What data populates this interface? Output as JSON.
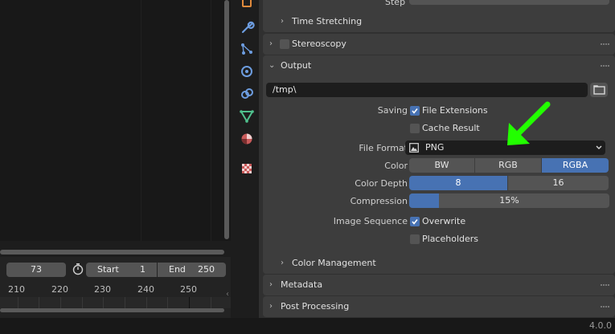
{
  "timeline": {
    "current_frame": "73",
    "start_label": "Start",
    "start_value": "1",
    "end_label": "End",
    "end_value": "250",
    "ticks": [
      "210",
      "220",
      "230",
      "240",
      "250"
    ]
  },
  "properties": {
    "step_label": "Step",
    "time_stretching": "Time Stretching",
    "stereoscopy": "Stereoscopy",
    "output": {
      "title": "Output",
      "path": "/tmp\\",
      "saving_label": "Saving",
      "file_extensions": "File Extensions",
      "cache_result": "Cache Result",
      "file_format_label": "File Format",
      "file_format_value": "PNG",
      "color_label": "Color",
      "color_options": [
        "BW",
        "RGB",
        "RGBA"
      ],
      "color_selected": "RGBA",
      "color_depth_label": "Color Depth",
      "color_depth_options": [
        "8",
        "16"
      ],
      "color_depth_selected": "8",
      "compression_label": "Compression",
      "compression_value": "15%",
      "compression_fraction": 0.15,
      "image_sequence_label": "Image Sequence",
      "overwrite": "Overwrite",
      "placeholders": "Placeholders"
    },
    "color_management": "Color Management",
    "metadata": "Metadata",
    "post_processing": "Post Processing"
  },
  "status": {
    "version": "4.0.0"
  },
  "colors": {
    "accent": "#4772b3",
    "annotation_arrow": "#22ff00",
    "panel": "#3d3d3d"
  },
  "icons": [
    "stopwatch-icon",
    "folder-icon",
    "image-icon",
    "chevron-down-icon",
    "wrench-icon",
    "particles-icon",
    "physics-icon",
    "constraints-icon",
    "data-icon",
    "material-icon",
    "texture-icon"
  ]
}
